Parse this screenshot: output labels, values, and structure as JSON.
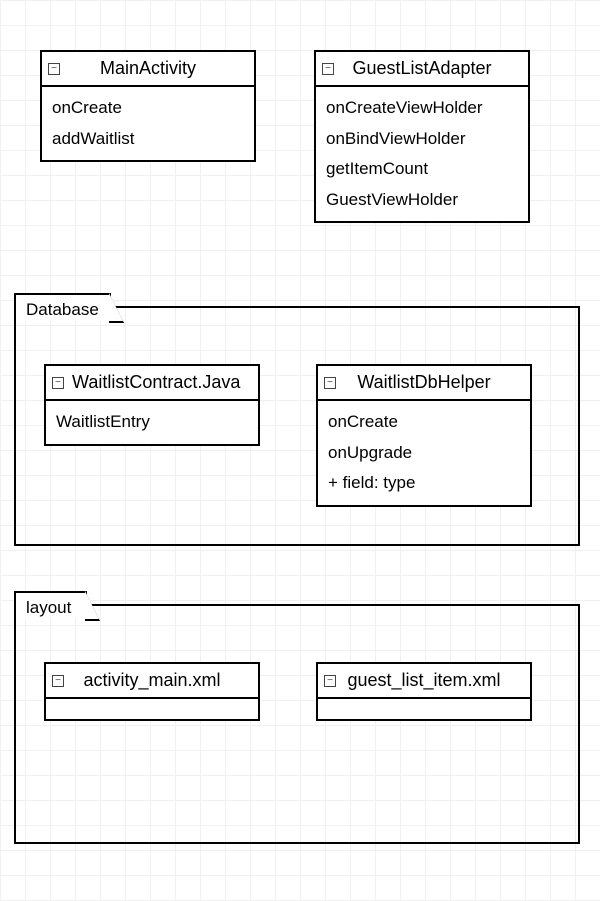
{
  "classes": {
    "main_activity": {
      "title": "MainActivity",
      "members": [
        "onCreate",
        "addWaitlist"
      ]
    },
    "guest_list_adapter": {
      "title": "GuestListAdapter",
      "members": [
        "onCreateViewHolder",
        "onBindViewHolder",
        "getItemCount",
        "GuestViewHolder"
      ]
    },
    "waitlist_contract": {
      "title": "WaitlistContract.Java",
      "members": [
        "WaitlistEntry"
      ]
    },
    "waitlist_db_helper": {
      "title": "WaitlistDbHelper",
      "members": [
        "onCreate",
        "onUpgrade",
        "+ field: type"
      ]
    },
    "activity_main_xml": {
      "title": "activity_main.xml",
      "members": []
    },
    "guest_list_item_xml": {
      "title": "guest_list_item.xml",
      "members": []
    }
  },
  "packages": {
    "database": "Database",
    "layout": "layout"
  },
  "icons": {
    "collapse_glyph": "−"
  }
}
